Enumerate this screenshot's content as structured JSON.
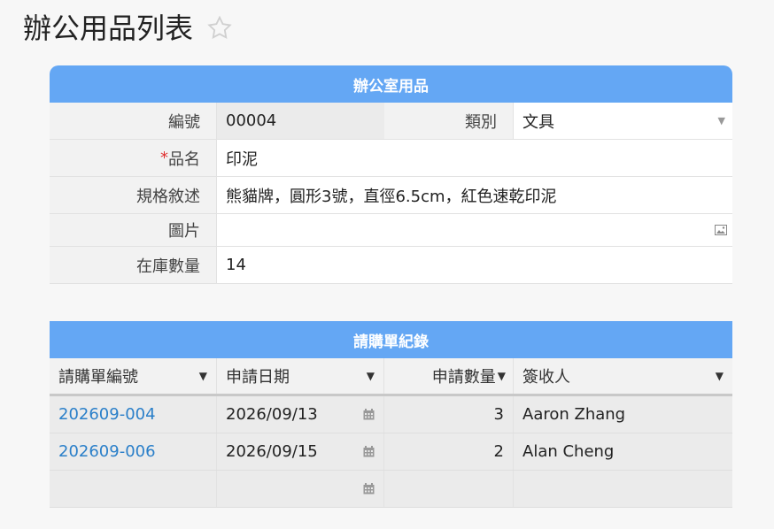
{
  "page": {
    "title": "辦公用品列表"
  },
  "form": {
    "header": "辦公室用品",
    "fields": {
      "id": {
        "label": "編號",
        "value": "00004"
      },
      "category": {
        "label": "類別",
        "value": "文具"
      },
      "name": {
        "required_mark": "*",
        "label": "品名",
        "value": "印泥"
      },
      "spec": {
        "label": "規格敘述",
        "value": "熊貓牌，圓形3號，直徑6.5cm，紅色速乾印泥"
      },
      "image": {
        "label": "圖片",
        "value": ""
      },
      "stock": {
        "label": "在庫數量",
        "value": "14"
      }
    }
  },
  "requests": {
    "header": "請購單紀錄",
    "columns": [
      "請購單編號",
      "申請日期",
      "申請數量",
      "簽收人"
    ],
    "rows": [
      {
        "id": "202609-004",
        "date": "2026/09/13",
        "qty": "3",
        "signer": "Aaron Zhang"
      },
      {
        "id": "202609-006",
        "date": "2026/09/15",
        "qty": "2",
        "signer": "Alan Cheng"
      }
    ]
  },
  "colors": {
    "accent": "#64a7f4",
    "link": "#2a7fc9",
    "required": "#e03030"
  },
  "icons": [
    "star-icon",
    "chevron-down-icon",
    "image-icon",
    "calendar-icon",
    "sort-icon"
  ]
}
